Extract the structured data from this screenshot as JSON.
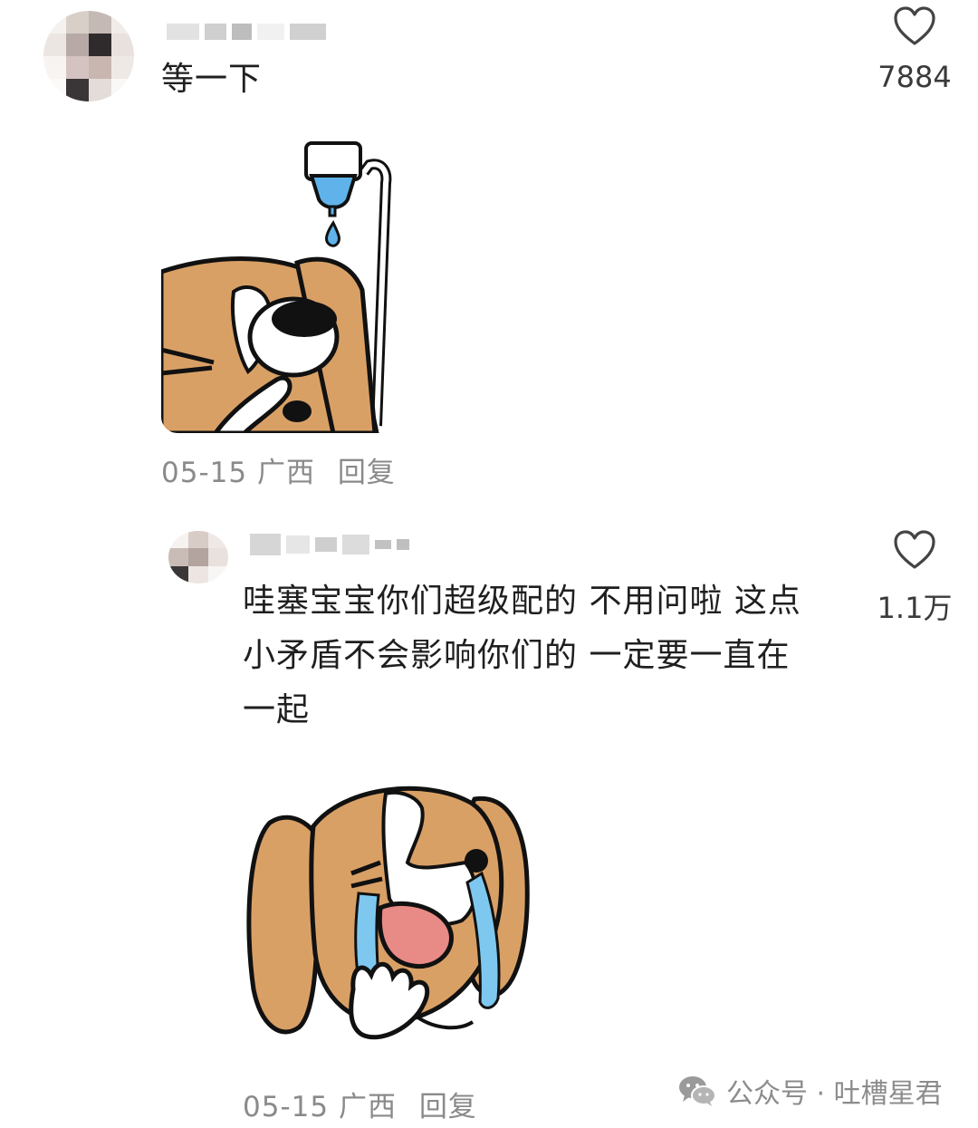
{
  "comments": [
    {
      "text": "等一下",
      "likes": "7884",
      "date": "05-15",
      "location": "广西",
      "reply_label": "回复",
      "sticker": "dog-eye-drops-sticker"
    },
    {
      "text_lines": [
        "哇塞宝宝你们超级配的 不用问啦 这点",
        "小矛盾不会影响你们的 一定要一直在",
        "一起"
      ],
      "likes": "1.1万",
      "date": "05-15",
      "location": "广西",
      "reply_label": "回复",
      "sticker": "dog-crying-sticker"
    }
  ],
  "watermark": {
    "icon": "wechat-icon",
    "text": "公众号 · 吐槽星君"
  },
  "colors": {
    "dog_brown": "#d9a066",
    "outline": "#111111",
    "tear_blue": "#7ec8f0",
    "tongue_pink": "#e88a86",
    "meta_gray": "#8a8a8a"
  }
}
